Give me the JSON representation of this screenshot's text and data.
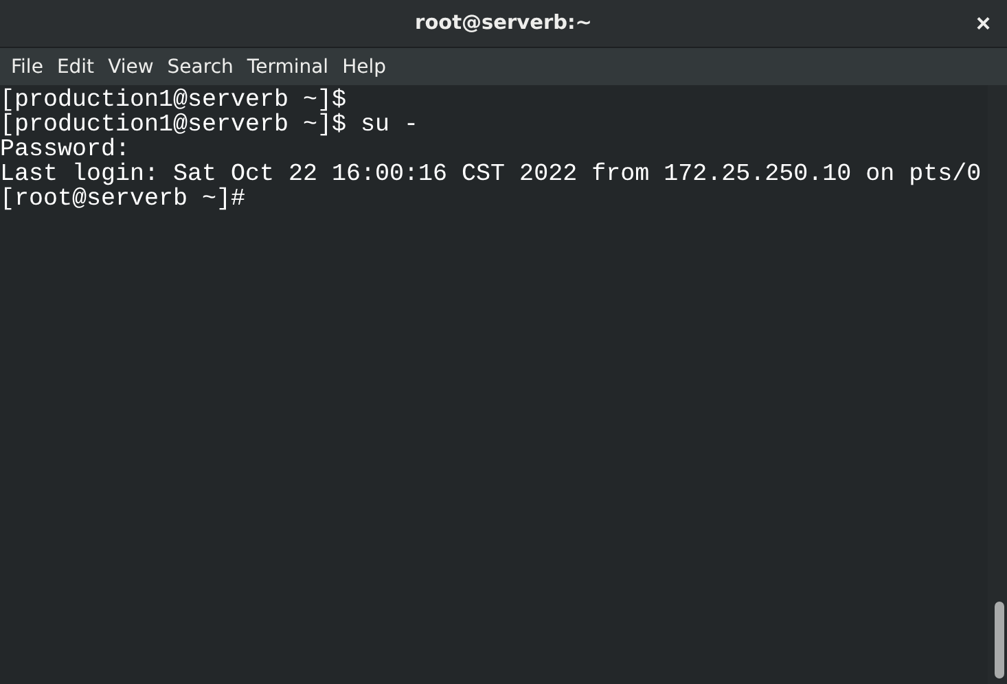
{
  "window": {
    "title": "root@serverb:~",
    "close": "×"
  },
  "menu": [
    "File",
    "Edit",
    "View",
    "Search",
    "Terminal",
    "Help"
  ],
  "terminal": {
    "lines": [
      "[production1@serverb ~]$",
      "[production1@serverb ~]$ su -",
      "Password:",
      "Last login: Sat Oct 22 16:00:16 CST 2022 from 172.25.250.10 on pts/0",
      "[root@serverb ~]#"
    ]
  }
}
